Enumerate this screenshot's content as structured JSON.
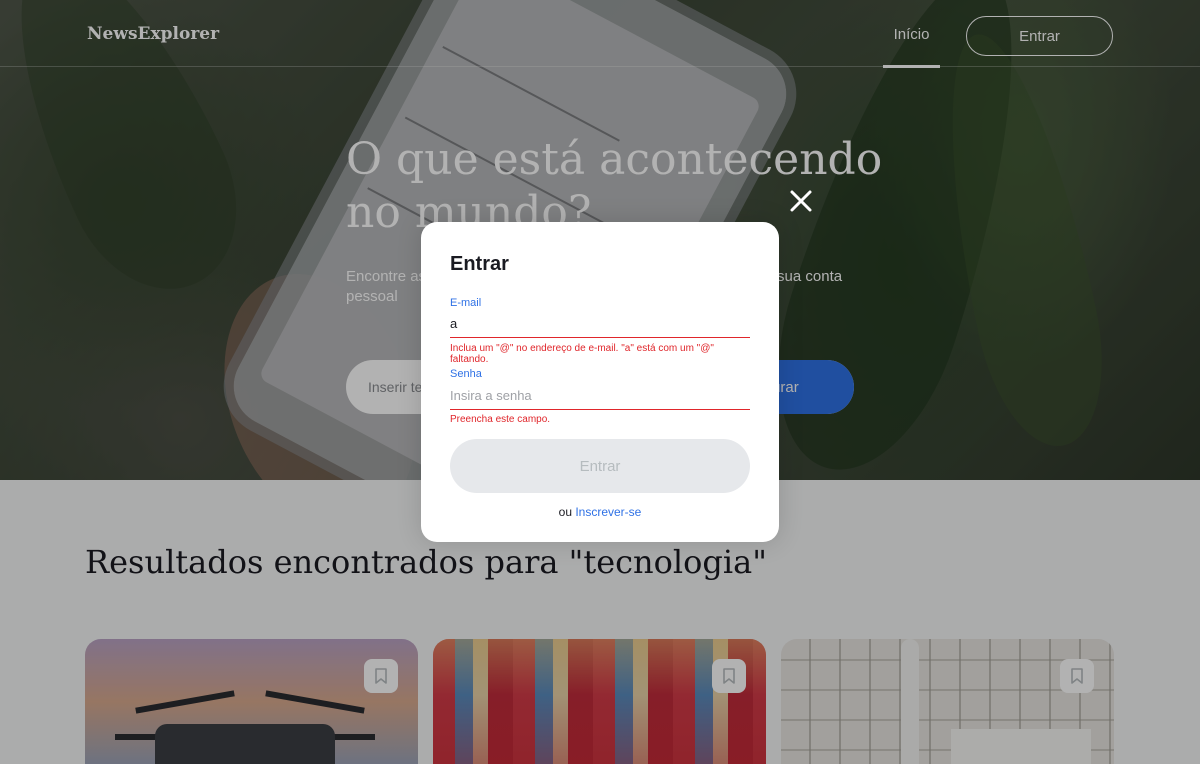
{
  "header": {
    "logo": "NewsExplorer",
    "nav_home": "Início",
    "nav_login": "Entrar"
  },
  "hero": {
    "title": "O que está acontecendo no mundo?",
    "subtitle": "Encontre as últimas notícias sobre qualquer tema e salve-as em sua conta pessoal",
    "search_placeholder": "Inserir tema",
    "search_button": "Procurar"
  },
  "results": {
    "title": "Resultados encontrados para \"tecnologia\"",
    "cards": [
      {
        "image": "drone-photo",
        "bookmark_icon": "bookmark-icon"
      },
      {
        "image": "market-stall-photo",
        "bookmark_icon": "bookmark-icon"
      },
      {
        "image": "kitchen-tiles-photo",
        "bookmark_icon": "bookmark-icon"
      }
    ]
  },
  "modal": {
    "title": "Entrar",
    "email_label": "E-mail",
    "email_value": "a",
    "email_error": "Inclua um \"@\" no endereço de e-mail. \"a\" está com um \"@\" faltando.",
    "password_label": "Senha",
    "password_placeholder": "Insira a senha",
    "password_error": "Preencha este campo.",
    "submit_label": "Entrar",
    "switch_prefix": "ou ",
    "switch_link": "Inscrever-se",
    "close_icon": "close-icon"
  },
  "colors": {
    "accent": "#2f71e5",
    "error": "#e0262b",
    "disabled_button": "#e6e8eb",
    "text_dark": "#1a1b22"
  }
}
